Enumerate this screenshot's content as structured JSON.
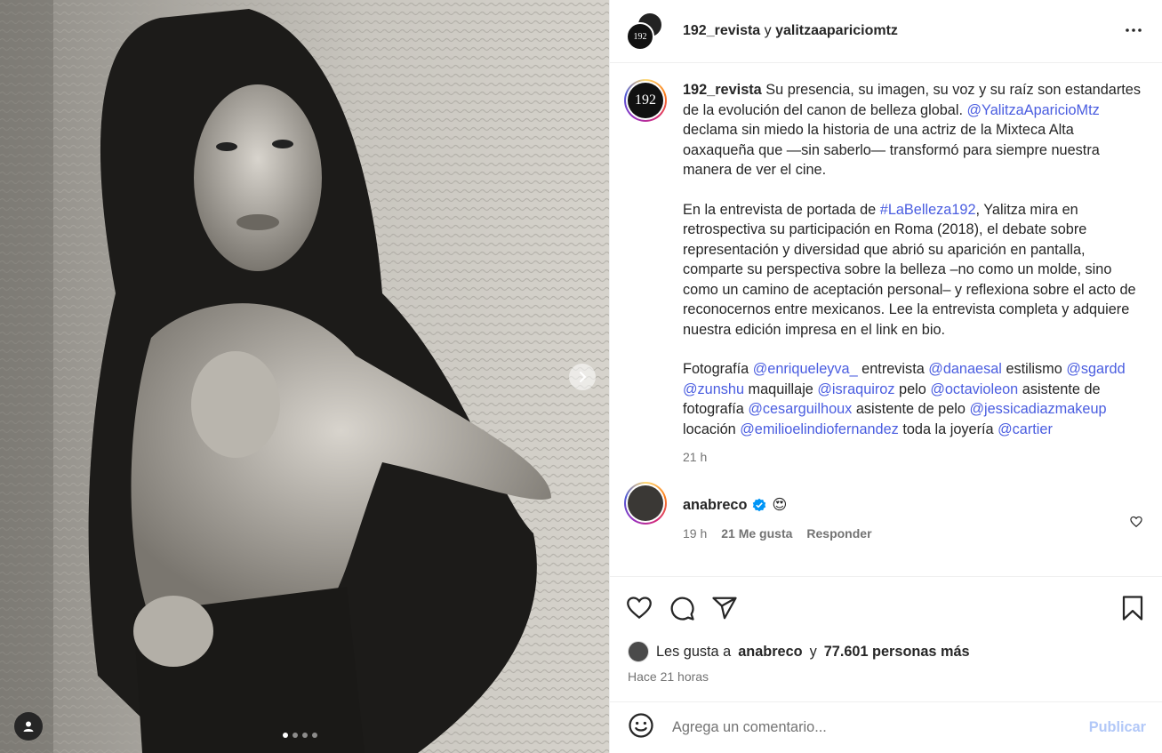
{
  "header": {
    "avatar_text": "192",
    "user1": "192_revista",
    "joiner": "y",
    "user2": "yalitzaapariciomtz"
  },
  "caption": {
    "avatar_text": "192",
    "username": "192_revista",
    "p1_a": " Su presencia, su imagen, su voz y su raíz son estandartes de la evolución del canon de belleza global. ",
    "p1_mention": "@YalitzaAparicioMtz",
    "p1_b": " declama sin miedo la historia de una actriz de la Mixteca Alta oaxaqueña que —sin saberlo— transformó para siempre nuestra manera de ver el cine.",
    "p2_a": "En la entrevista de portada de ",
    "p2_hashtag": "#LaBelleza192",
    "p2_b": ", Yalitza mira en retrospectiva su participación en Roma (2018), el debate sobre representación y diversidad que abrió su aparición en pantalla, comparte su perspectiva sobre la belleza –no como un molde, sino como un camino de aceptación personal– y reflexiona sobre el acto de reconocernos entre mexicanos. Lee la entrevista completa y adquiere nuestra edición impresa en el link en bio.",
    "credits": [
      {
        "t": "Fotografía "
      },
      {
        "m": "@enriqueleyva_"
      },
      {
        "t": " entrevista "
      },
      {
        "m": "@danaesal"
      },
      {
        "t": " estilismo "
      },
      {
        "m": "@sgardd"
      },
      {
        "t": " "
      },
      {
        "m": "@zunshu"
      },
      {
        "t": " maquillaje "
      },
      {
        "m": "@israquiroz"
      },
      {
        "t": " pelo "
      },
      {
        "m": "@octavioleon"
      },
      {
        "t": " asistente de fotografía "
      },
      {
        "m": "@cesarguilhoux"
      },
      {
        "t": " asistente de pelo "
      },
      {
        "m": "@jessicadiazmakeup"
      },
      {
        "t": " locación "
      },
      {
        "m": "@emilioelindiofernandez"
      },
      {
        "t": " toda la joyería "
      },
      {
        "m": "@cartier"
      }
    ],
    "time": "21 h"
  },
  "comment": {
    "username": "anabreco",
    "emoji": "😍",
    "time": "19 h",
    "likes": "21 Me gusta",
    "reply": "Responder"
  },
  "likes": {
    "prefix": "Les gusta a",
    "user": "anabreco",
    "joiner": "y",
    "count": "77.601 personas más"
  },
  "time_ago": "Hace 21 horas",
  "add_comment": {
    "placeholder": "Agrega un comentario...",
    "publish": "Publicar"
  },
  "carousel": {
    "count": 4,
    "active": 0
  },
  "colors": {
    "link": "#4a5de0",
    "publish_disabled": "#b2c8f8",
    "verified": "#0095f6"
  },
  "icons": [
    "chevron-right-icon",
    "user-tag-icon",
    "more-icon",
    "heart-icon",
    "comment-icon",
    "share-icon",
    "bookmark-icon",
    "emoji-icon",
    "verified-icon"
  ]
}
